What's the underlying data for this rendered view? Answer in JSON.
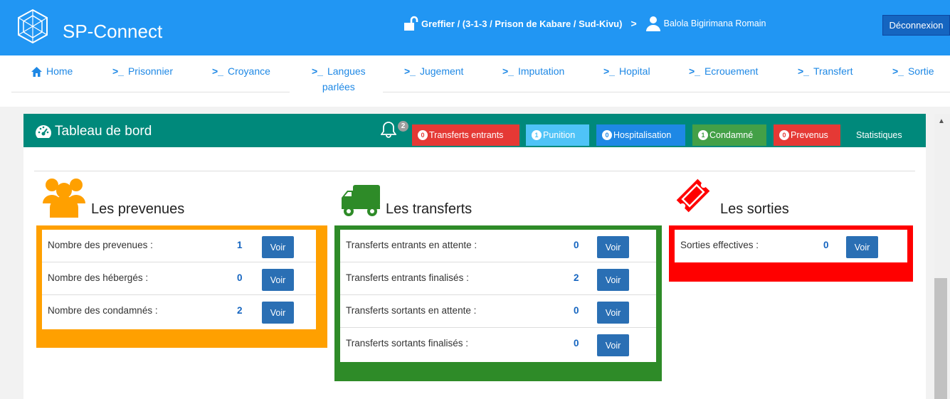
{
  "app": {
    "brand": "SP-Connect",
    "role": "Greffier / (3-1-3 / Prison de Kabare / Sud-Kivu)",
    "user": "Balola Bigirimana Romain",
    "logout": "Déconnexion"
  },
  "nav": [
    {
      "label": "Home",
      "icon": "home-icon"
    },
    {
      "label": "Prisonnier",
      "icon": "terminal-icon"
    },
    {
      "label": "Croyance",
      "icon": "terminal-icon"
    },
    {
      "label": "Langues",
      "label2": "parlées",
      "icon": "terminal-icon"
    },
    {
      "label": "Jugement",
      "icon": "terminal-icon"
    },
    {
      "label": "Imputation",
      "icon": "terminal-icon"
    },
    {
      "label": "Hopital",
      "icon": "terminal-icon"
    },
    {
      "label": "Ecrouement",
      "icon": "terminal-icon"
    },
    {
      "label": "Transfert",
      "icon": "terminal-icon"
    },
    {
      "label": "Sortie",
      "icon": "terminal-icon"
    }
  ],
  "dashboard": {
    "title": "Tableau de bord",
    "bell_count": "2",
    "buttons": [
      {
        "count": "0",
        "label": "Transferts entrants",
        "color": "#e53935"
      },
      {
        "count": "1",
        "label": "Punition",
        "color": "#4fc3f7"
      },
      {
        "count": "0",
        "label": "Hospitalisation",
        "color": "#1e88e5"
      },
      {
        "count": "1",
        "label": "Condamné",
        "color": "#43a047"
      },
      {
        "count": "0",
        "label": "Prevenus",
        "color": "#e53935"
      }
    ],
    "stats_label": "Statistiques"
  },
  "prevenues": {
    "title": "Les prevenues",
    "color": "#ffa000",
    "rows": [
      {
        "label": "Nombre des prevenues :",
        "value": "1",
        "button": "Voir"
      },
      {
        "label": "Nombre des hébergés :",
        "value": "0",
        "button": "Voir"
      },
      {
        "label": "Nombre des condamnés :",
        "value": "2",
        "button": "Voir"
      }
    ]
  },
  "transferts": {
    "title": "Les transferts",
    "color": "#2e8b28",
    "rows": [
      {
        "label": "Transferts entrants en attente :",
        "value": "0",
        "button": "Voir"
      },
      {
        "label": "Transferts entrants finalisés :",
        "value": "2",
        "button": "Voir"
      },
      {
        "label": "Transferts sortants en attente :",
        "value": "0",
        "button": "Voir"
      },
      {
        "label": "Transferts sortants finalisés :",
        "value": "0",
        "button": "Voir"
      }
    ]
  },
  "sorties": {
    "title": "Les sorties",
    "color": "#ff0000",
    "rows": [
      {
        "label": "Sorties effectives :",
        "value": "0",
        "button": "Voir"
      }
    ]
  }
}
